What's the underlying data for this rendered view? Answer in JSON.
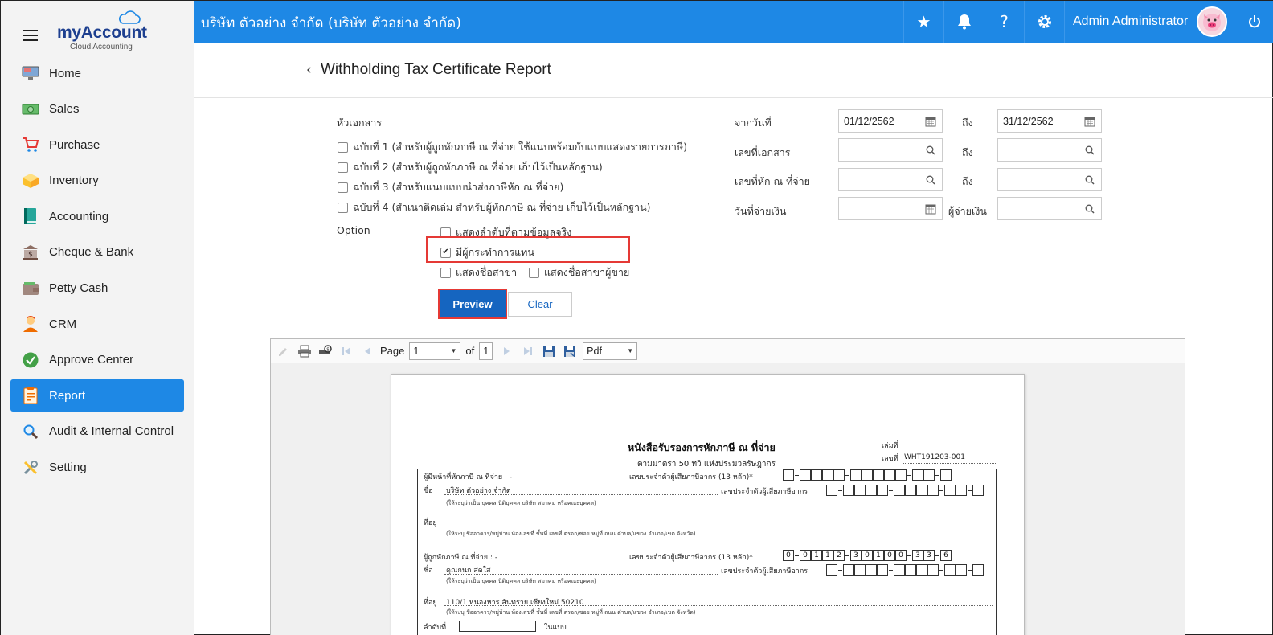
{
  "brand": {
    "name_my": "my",
    "name_account": "Account",
    "subtitle": "Cloud Accounting"
  },
  "sidebar": {
    "items": [
      {
        "label": "Home",
        "icon": "monitor-icon"
      },
      {
        "label": "Sales",
        "icon": "cash-icon"
      },
      {
        "label": "Purchase",
        "icon": "cart-icon"
      },
      {
        "label": "Inventory",
        "icon": "box-icon"
      },
      {
        "label": "Accounting",
        "icon": "book-icon"
      },
      {
        "label": "Cheque & Bank",
        "icon": "bank-icon"
      },
      {
        "label": "Petty Cash",
        "icon": "wallet-icon"
      },
      {
        "label": "CRM",
        "icon": "person-icon"
      },
      {
        "label": "Approve Center",
        "icon": "check-circle-icon"
      },
      {
        "label": "Report",
        "icon": "report-icon",
        "active": true
      },
      {
        "label": "Audit & Internal Control",
        "icon": "magnifier-icon"
      },
      {
        "label": "Setting",
        "icon": "tools-icon"
      }
    ]
  },
  "topbar": {
    "company": "บริษัท ตัวอย่าง จำกัด (บริษัท ตัวอย่าง จำกัด)",
    "user": "Admin Administrator",
    "help": "?"
  },
  "page": {
    "title": "Withholding Tax Certificate Report"
  },
  "form": {
    "header_label": "หัวเอกสาร",
    "copies": [
      {
        "label": "ฉบับที่ 1 (สำหรับผู้ถูกหักภาษี ณ ที่จ่าย ใช้แนบพร้อมกับแบบแสดงรายการภาษี)",
        "checked": false
      },
      {
        "label": "ฉบับที่ 2 (สำหรับผู้ถูกหักภาษี ณ ที่จ่าย เก็บไว้เป็นหลักฐาน)",
        "checked": false
      },
      {
        "label": "ฉบับที่ 3 (สำหรับแนบแบบนำส่งภาษีหัก ณ ที่จ่าย)",
        "checked": false
      },
      {
        "label": "ฉบับที่ 4 (สำเนาติดเล่ม สำหรับผู้หักภาษี ณ ที่จ่าย เก็บไว้เป็นหลักฐาน)",
        "checked": false
      }
    ],
    "option_label": "Option",
    "options": {
      "show_sequence": {
        "label": "แสดงลำดับที่ตามข้อมูลจริง",
        "checked": false
      },
      "has_agent": {
        "label": "มีผู้กระทำการแทน",
        "checked": true
      },
      "show_branch": {
        "label": "แสดงชื่อสาขา",
        "checked": false
      },
      "show_vendor_branch": {
        "label": "แสดงชื่อสาขาผู้ขาย",
        "checked": false
      }
    },
    "from_date_label": "จากวันที่",
    "from_date": "01/12/2562",
    "to_label": "ถึง",
    "to_date": "31/12/2562",
    "doc_no_label": "เลขที่เอกสาร",
    "wht_no_label": "เลขที่หัก ณ ที่จ่าย",
    "pay_date_label": "วันที่จ่ายเงิน",
    "payer_label": "ผู้จ่ายเงิน",
    "preview_button": "Preview",
    "clear_button": "Clear"
  },
  "viewer": {
    "page_label": "Page",
    "page_value": "1",
    "of_label": "of",
    "total_pages": "1",
    "format": "Pdf"
  },
  "document": {
    "title": "หนังสือรับรองการหักภาษี ณ ที่จ่าย",
    "subtitle": "ตามมาตรา 50 ทวิ แห่งประมวลรัษฎากร",
    "book_no_label": "เล่มที่",
    "doc_no_label": "เลขที่",
    "doc_no": "WHT191203-001",
    "payer_section": "ผู้มีหน้าที่หักภาษี ณ ที่จ่าย : -",
    "tax_id_13_label": "เลขประจำตัวผู้เสียภาษีอากร (13 หลัก)*",
    "tax_id_label": "เลขประจำตัวผู้เสียภาษีอากร",
    "name_label": "ชื่อ",
    "payer_name": "บริษัท ตัวอย่าง จำกัด",
    "name_hint": "(ให้ระบุว่าเป็น บุคคล นิติบุคคล บริษัท สมาคม หรือคณะบุคคล)",
    "address_label": "ที่อยู่",
    "address_hint": "(ให้ระบุ ชื่ออาคาร/หมู่บ้าน ห้องเลขที่ ชั้นที่ เลขที่ ตรอก/ซอย หมู่ที่ ถนน ตำบล/แขวง อำเภอ/เขต จังหวัด)",
    "payee_section": "ผู้ถูกหักภาษี ณ ที่จ่าย : -",
    "payee_tax_digits": [
      "0",
      "0",
      "1",
      "1",
      "2",
      "3",
      "0",
      "1",
      "0",
      "0",
      "3",
      "3",
      "6"
    ],
    "payee_name": "คุณกนก สดใส",
    "payee_address": "110/1 หนองหาร สันทราย เชียงใหม่ 50210",
    "seq_label": "ลำดับที่",
    "in_form_label": "ในแบบ"
  }
}
